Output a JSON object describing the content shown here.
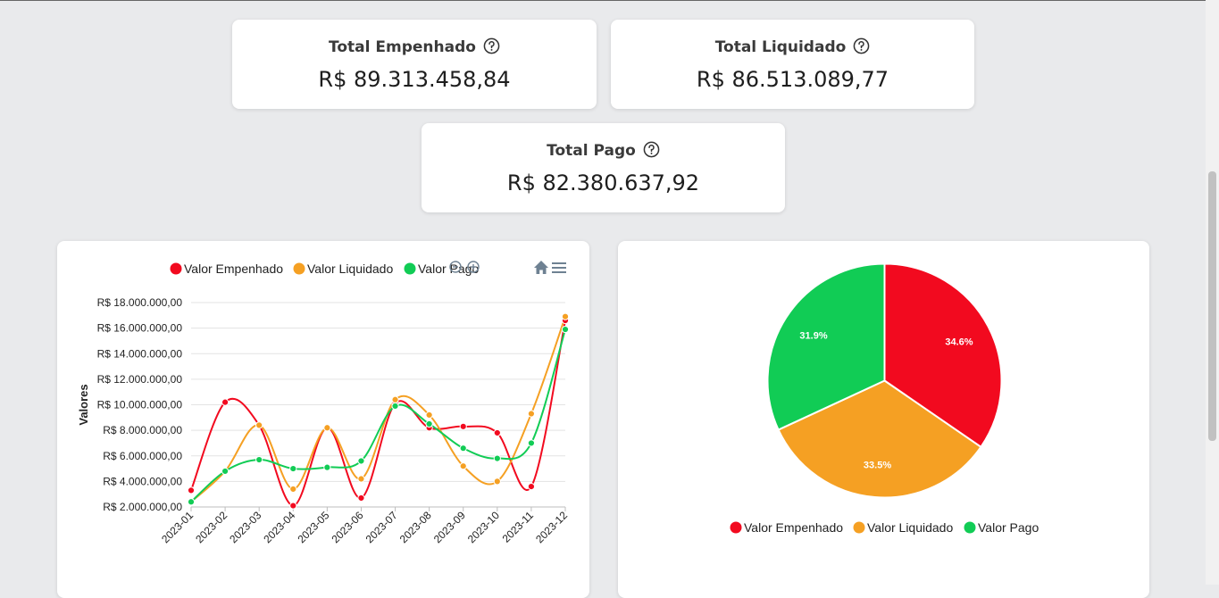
{
  "cards": [
    {
      "title": "Total Empenhado",
      "value": "R$ 89.313.458,84"
    },
    {
      "title": "Total Liquidado",
      "value": "R$ 86.513.089,77"
    },
    {
      "title": "Total Pago",
      "value": "R$ 82.380.637,92"
    }
  ],
  "toolbar": {
    "icons": [
      "zoom-out-icon",
      "zoom-in-icon",
      "home-icon",
      "menu-icon"
    ]
  },
  "colors": {
    "empenhado": "#f20a1f",
    "liquidado": "#f5a023",
    "pago": "#11cc55"
  },
  "chart_data": [
    {
      "type": "line",
      "x": [
        "2023-01",
        "2023-02",
        "2023-03",
        "2023-04",
        "2023-05",
        "2023-06",
        "2023-07",
        "2023-08",
        "2023-09",
        "2023-10",
        "2023-11",
        "2023-12"
      ],
      "series": [
        {
          "name": "Valor Empenhado",
          "values": [
            3300000,
            10200000,
            8400000,
            2100000,
            8200000,
            2700000,
            10100000,
            8200000,
            8300000,
            7800000,
            3600000,
            16600000
          ]
        },
        {
          "name": "Valor Liquidado",
          "values": [
            2400000,
            4800000,
            8400000,
            3400000,
            8200000,
            4200000,
            10400000,
            9200000,
            5200000,
            4000000,
            9300000,
            16900000
          ]
        },
        {
          "name": "Valor Pago",
          "values": [
            2400000,
            4800000,
            5700000,
            5000000,
            5100000,
            5600000,
            9900000,
            8500000,
            6600000,
            5800000,
            7000000,
            15900000
          ]
        }
      ],
      "ylabel": "Valores",
      "ylim": [
        2000000,
        18000000
      ],
      "yticks": [
        "R$ 2.000.000,00",
        "R$ 4.000.000,00",
        "R$ 6.000.000,00",
        "R$ 8.000.000,00",
        "R$ 10.000.000,00",
        "R$ 12.000.000,00",
        "R$ 14.000.000,00",
        "R$ 16.000.000,00",
        "R$ 18.000.000,00"
      ],
      "grid": true,
      "legend": "top"
    },
    {
      "type": "pie",
      "categories": [
        "Valor Empenhado",
        "Valor Liquidado",
        "Valor Pago"
      ],
      "values": [
        34.6,
        33.5,
        31.9
      ],
      "labels": [
        "34.6%",
        "33.5%",
        "31.9%"
      ],
      "legend": "bottom"
    }
  ]
}
